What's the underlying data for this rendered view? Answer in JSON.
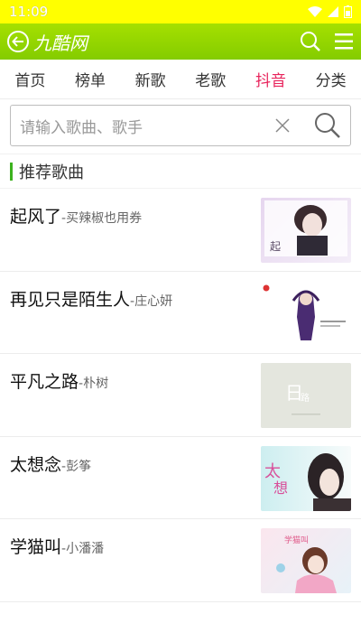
{
  "status": {
    "time": "11:09"
  },
  "app": {
    "title": "九酷网"
  },
  "tabs": [
    {
      "label": "首页"
    },
    {
      "label": "榜单"
    },
    {
      "label": "新歌"
    },
    {
      "label": "老歌"
    },
    {
      "label": "抖音"
    },
    {
      "label": "分类"
    }
  ],
  "active_tab": "抖音",
  "search": {
    "placeholder": "请输入歌曲、歌手"
  },
  "section": {
    "title": "推荐歌曲"
  },
  "songs": [
    {
      "title": "起风了",
      "artist": "-买辣椒也用券"
    },
    {
      "title": "再见只是陌生人",
      "artist": "-庄心妍"
    },
    {
      "title": "平凡之路",
      "artist": "-朴树"
    },
    {
      "title": "太想念",
      "artist": "-彭筝"
    },
    {
      "title": "学猫叫",
      "artist": "-小潘潘"
    }
  ],
  "colors": {
    "statusbar": "#ffff00",
    "appbar": "#8ed400",
    "accent": "#e8245c",
    "section_bar": "#3cb21e"
  }
}
